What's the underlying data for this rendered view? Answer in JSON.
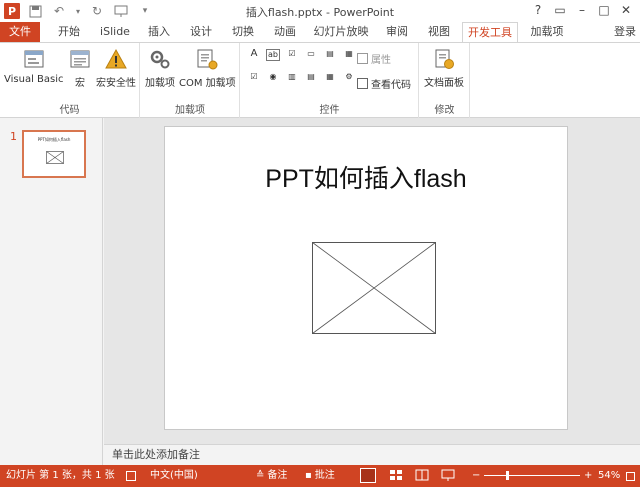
{
  "window": {
    "title": "插入flash.pptx - PowerPoint",
    "help": "?",
    "login": "登录"
  },
  "ribbon": {
    "tabs": [
      "文件",
      "开始",
      "iSlide",
      "插入",
      "设计",
      "切换",
      "动画",
      "幻灯片放映",
      "审阅",
      "视图",
      "开发工具",
      "加载项"
    ],
    "active_tab": "开发工具",
    "groups": {
      "code": {
        "label": "代码",
        "buttons": [
          "Visual Basic",
          "宏",
          "宏安全性"
        ]
      },
      "addins": {
        "label": "加载项",
        "buttons": [
          "加载项",
          "COM 加载项"
        ]
      },
      "controls": {
        "label": "控件",
        "properties": "属性",
        "view_code": "查看代码",
        "small": [
          "A",
          "ab",
          "☑",
          "▭",
          "▤",
          "▦",
          "☑",
          "◉",
          "▥",
          "▤",
          "▦",
          "⚙"
        ]
      },
      "modify": {
        "label": "修改",
        "buttons": [
          "文档面板"
        ]
      }
    }
  },
  "thumbnails": [
    {
      "number": "1",
      "title": "PPT如何插入flash"
    }
  ],
  "slide": {
    "title": "PPT如何插入flash"
  },
  "notes": {
    "placeholder": "单击此处添加备注"
  },
  "status": {
    "slide_info": "幻灯片 第 1 张，共 1 张",
    "language": "中文(中国)",
    "notes": "备注",
    "comments": "批注",
    "zoom": "54%",
    "zoom_fraction": 0.54
  },
  "colors": {
    "accent": "#d04423",
    "ribbon_bg": "#ffffff",
    "editor_bg": "#e6e6e6"
  }
}
